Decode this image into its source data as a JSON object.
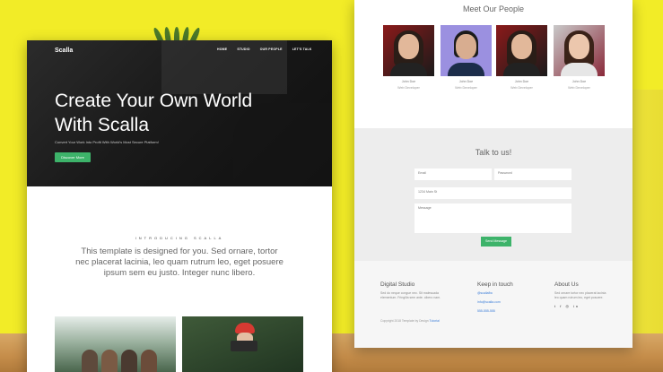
{
  "left_page": {
    "brand": "Scalla",
    "nav": [
      "HOME",
      "STUDIO",
      "OUR PEOPLE",
      "LET'S TALK"
    ],
    "hero_title": "Create Your Own World With Scalla",
    "hero_subtitle": "Convert Your Work Into Profit With World's Most Secure Platform!",
    "hero_button": "Discover More",
    "intro_label": "INTRODUCING SCALLA",
    "intro_text": "This template is designed for you. Sed ornare, tortor nec placerat lacinia, leo quam rutrum leo, eget posuere ipsum sem eu justo. Integer nunc libero."
  },
  "right_page": {
    "people_title": "Meet Our People",
    "people": [
      {
        "name": "John Doe",
        "role": "Web Developer"
      },
      {
        "name": "John Doe",
        "role": "Web Developer"
      },
      {
        "name": "John Doe",
        "role": "Web Developer"
      },
      {
        "name": "John Doe",
        "role": "Web Developer"
      }
    ],
    "contact_title": "Talk to us!",
    "contact_form": {
      "email_placeholder": "Email",
      "password_placeholder": "Password",
      "address_placeholder": "1234 Main St",
      "message_placeholder": "Message",
      "send_label": "Send Message"
    },
    "footer": {
      "col1_title": "Digital Studio",
      "col1_text": "Sed do neque congue nec. Sit malesuada elementum. Fringilla sem ante. cibero nam.",
      "col2_title": "Keep in touch",
      "col2_links": [
        "@scallafbc",
        "info@scalla.com",
        "555-555-555"
      ],
      "col3_title": "About Us",
      "col3_text": "Sed ornare tortor nec placerat lacinia leo quam rutrum leo, eget posuere.",
      "social": "t f ◎ in",
      "copyright": "Copyright 2018 Template by Design",
      "copyright_link": "Tutorial"
    }
  }
}
